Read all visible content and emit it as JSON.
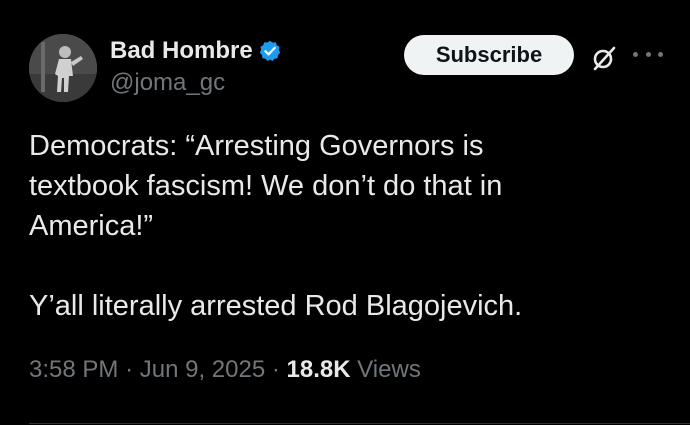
{
  "author": {
    "display_name": "Bad Hombre",
    "handle": "@joma_gc",
    "verified": true,
    "verified_color": "#1d9bf0"
  },
  "header": {
    "subscribe_label": "Subscribe",
    "icons": [
      "grok-icon",
      "more-icon"
    ]
  },
  "tweet": {
    "lines": [
      "Democrats: “Arresting Governors is",
      "textbook fascism! We don’t do that in",
      "America!”",
      "",
      "Y’all literally arrested Rod Blagojevich."
    ]
  },
  "meta": {
    "time": "3:58 PM",
    "date": "Jun 9, 2025",
    "views_count": "18.8K",
    "views_label": "Views"
  },
  "colors": {
    "background": "#000000",
    "text": "#e7e9ea",
    "secondary_text": "#71767b",
    "button_bg": "#eff3f4"
  }
}
